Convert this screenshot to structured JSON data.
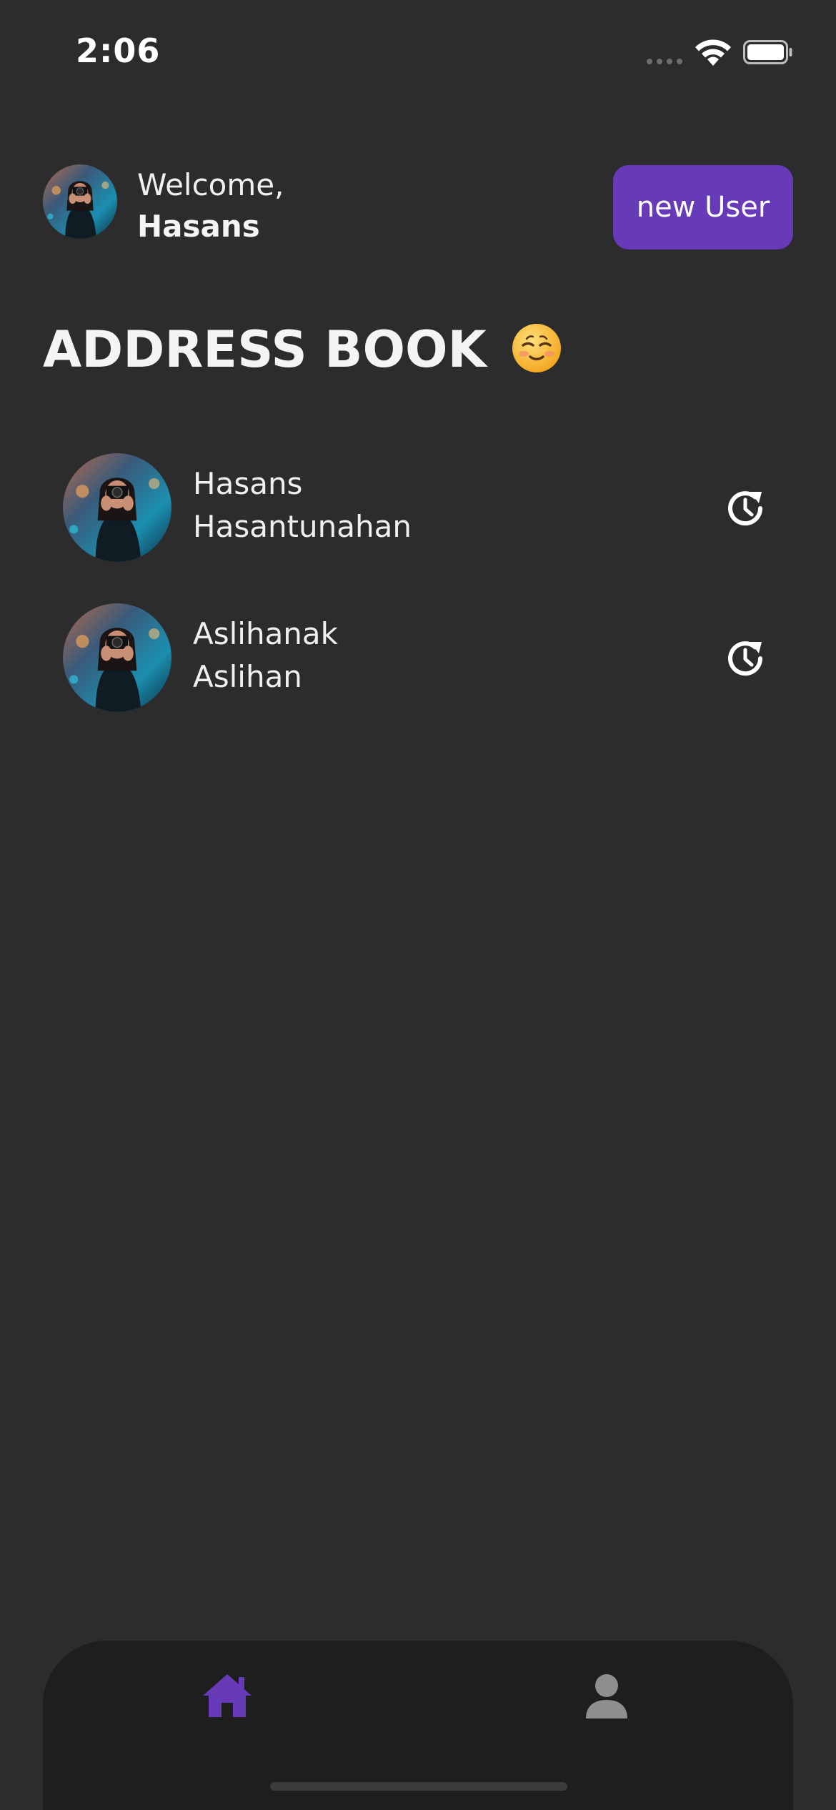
{
  "status_bar": {
    "time": "2:06",
    "icons": [
      "cellular-signal-icon",
      "wifi-icon",
      "battery-icon"
    ]
  },
  "header": {
    "welcome_text": "Welcome,",
    "username": "Hasans",
    "new_user_label": "new User"
  },
  "page_title": "ADDRESS BOOK",
  "page_title_emoji": "smiling-face-emoji",
  "contacts": [
    {
      "first": "Hasans",
      "last": "Hasantunahan",
      "action_icon": "history-icon"
    },
    {
      "first": "Aslihanak",
      "last": "Aslihan",
      "action_icon": "history-icon"
    }
  ],
  "bottom_nav": {
    "items": [
      {
        "icon": "home-icon",
        "active": true
      },
      {
        "icon": "user-icon",
        "active": false
      }
    ]
  },
  "colors": {
    "background": "#2c2c2d",
    "accent": "#673ab7",
    "nav_background": "#1e1e1e",
    "inactive_icon": "#8e8e90",
    "text": "#ffffff"
  }
}
